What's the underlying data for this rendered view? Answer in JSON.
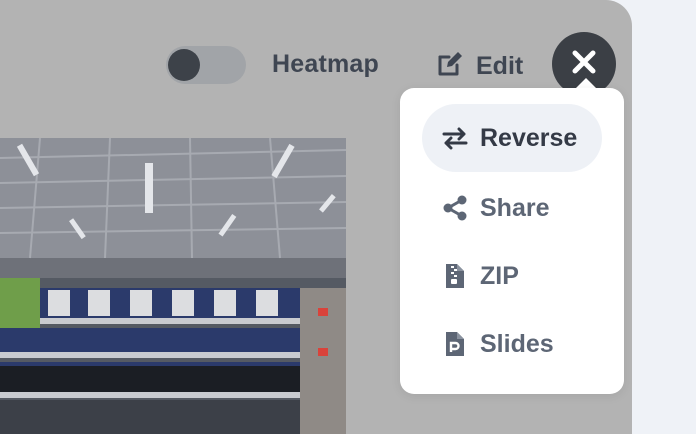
{
  "toolbar": {
    "heatmap_label": "Heatmap",
    "heatmap_enabled": false,
    "edit_label": "Edit"
  },
  "menu": {
    "items": [
      {
        "label": "Reverse",
        "icon": "swap-arrows-icon",
        "active": true
      },
      {
        "label": "Share",
        "icon": "share-icon",
        "active": false
      },
      {
        "label": "ZIP",
        "icon": "zip-file-icon",
        "active": false
      },
      {
        "label": "Slides",
        "icon": "slides-file-icon",
        "active": false
      }
    ]
  },
  "colors": {
    "overlay": "#b3b3b3",
    "page_background": "#eff2f7",
    "text_dark": "#3f4652",
    "menu_text": "#5d6675",
    "close_button": "#3b3f45"
  }
}
